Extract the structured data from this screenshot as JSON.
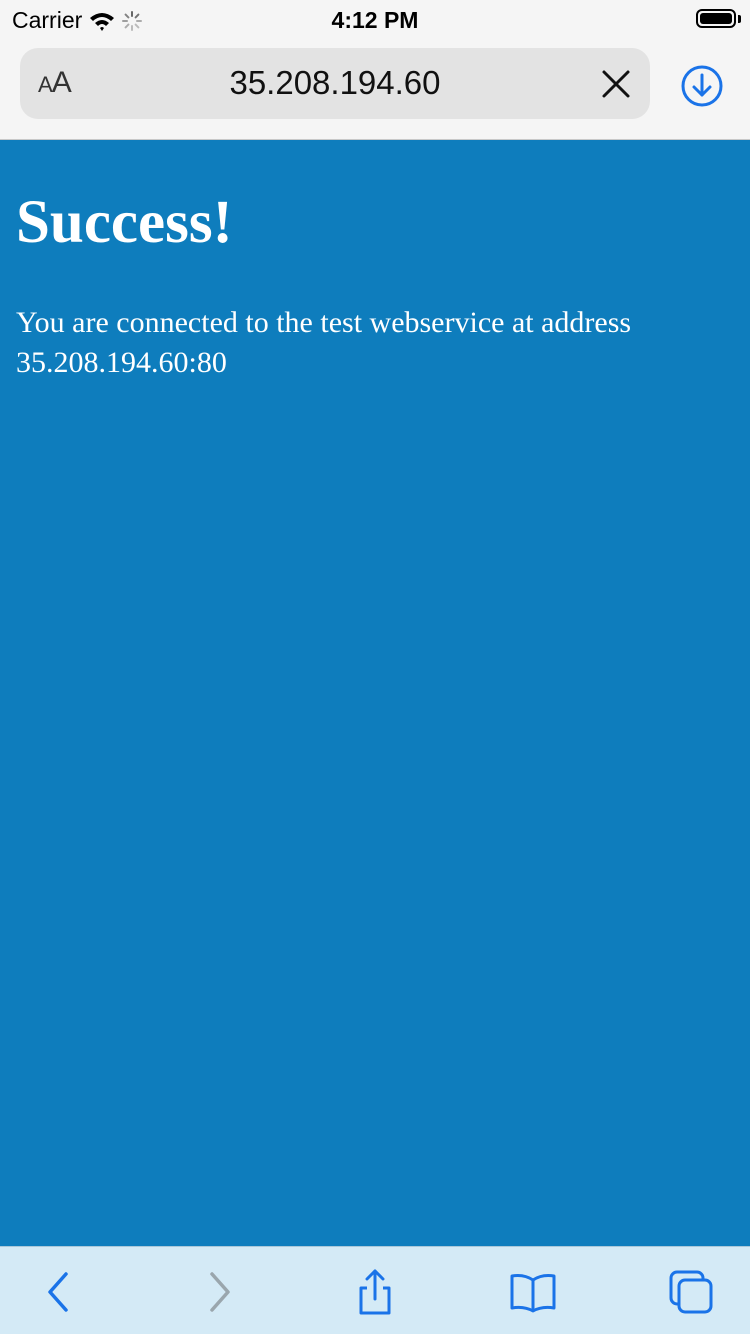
{
  "status_bar": {
    "carrier": "Carrier",
    "time": "4:12 PM",
    "wifi_icon": "wifi-icon",
    "activity_icon": "loading-spinner-icon",
    "battery_icon": "battery-icon"
  },
  "browser": {
    "text_size_label_small": "A",
    "text_size_label_large": "A",
    "url": "35.208.194.60",
    "clear_icon": "close-icon",
    "download_icon": "download-icon",
    "accent_color": "#1a73e8",
    "toolbar": {
      "back_icon": "chevron-left-icon",
      "forward_icon": "chevron-right-icon",
      "share_icon": "share-icon",
      "bookmarks_icon": "book-icon",
      "tabs_icon": "tabs-icon"
    }
  },
  "page": {
    "background_color": "#0e7dbd",
    "heading": "Success!",
    "message": "You are connected to the test webservice at address 35.208.194.60:80"
  }
}
